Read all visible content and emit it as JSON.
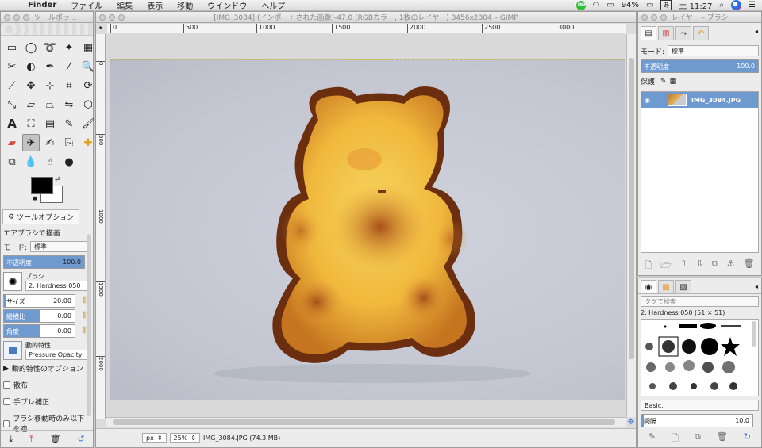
{
  "menubar": {
    "app": "Finder",
    "items": [
      "ファイル",
      "編集",
      "表示",
      "移動",
      "ウインドウ",
      "ヘルプ"
    ],
    "line_badge": "LINE",
    "battery": "94%",
    "ime": "あ",
    "clock": "土 11:27"
  },
  "toolbox": {
    "title": "ツールボッ...",
    "options_tab": "ツールオプション",
    "tool_name": "エアブラシで描画",
    "mode_label": "モード:",
    "mode_value": "標準",
    "opacity_label": "不透明度",
    "opacity_value": "100.0",
    "brush_label": "ブラシ",
    "brush_value": "2. Hardness 050",
    "size_label": "サイズ",
    "size_value": "20.00",
    "aspect_label": "縦横比",
    "aspect_value": "0.00",
    "angle_label": "角度",
    "angle_value": "0.00",
    "dynamics_label": "動的特性",
    "dynamics_value": "Pressure Opacity",
    "dynamics_options": "動的特性のオプション",
    "scatter": "散布",
    "smooth": "手ブレ補正",
    "lock_brush": "ブラシ移動時のみ以下を適",
    "opacity_fraction": 1.0,
    "size_fraction": 0.02,
    "aspect_fraction": 0.5,
    "angle_fraction": 0.5
  },
  "imagewin": {
    "title": "[IMG_3084] (インポートされた画像)-47.0 (RGBカラー, 1枚のレイヤー) 3456x2304 – GIMP",
    "ruler_h": [
      "0",
      "500",
      "1000",
      "1500",
      "2000",
      "2500",
      "3000"
    ],
    "ruler_v": [
      "0",
      "500",
      "1000",
      "1500",
      "2000"
    ],
    "unit": "px",
    "zoom": "25%",
    "status": "IMG_3084.JPG (74.3 MB)"
  },
  "layers": {
    "title": "レイヤー - ブラシ",
    "mode_label": "モード:",
    "mode_value": "標準",
    "opacity_label": "不透明度",
    "opacity_value": "100.0",
    "lock_label": "保護:",
    "layer_name": "IMG_3084.JPG"
  },
  "brushes": {
    "tag_placeholder": "タグで検索",
    "selected_brush": "2. Hardness 050 (51 × 51)",
    "preset": "Basic,",
    "spacing_label": "間隔",
    "spacing_value": "10.0"
  }
}
